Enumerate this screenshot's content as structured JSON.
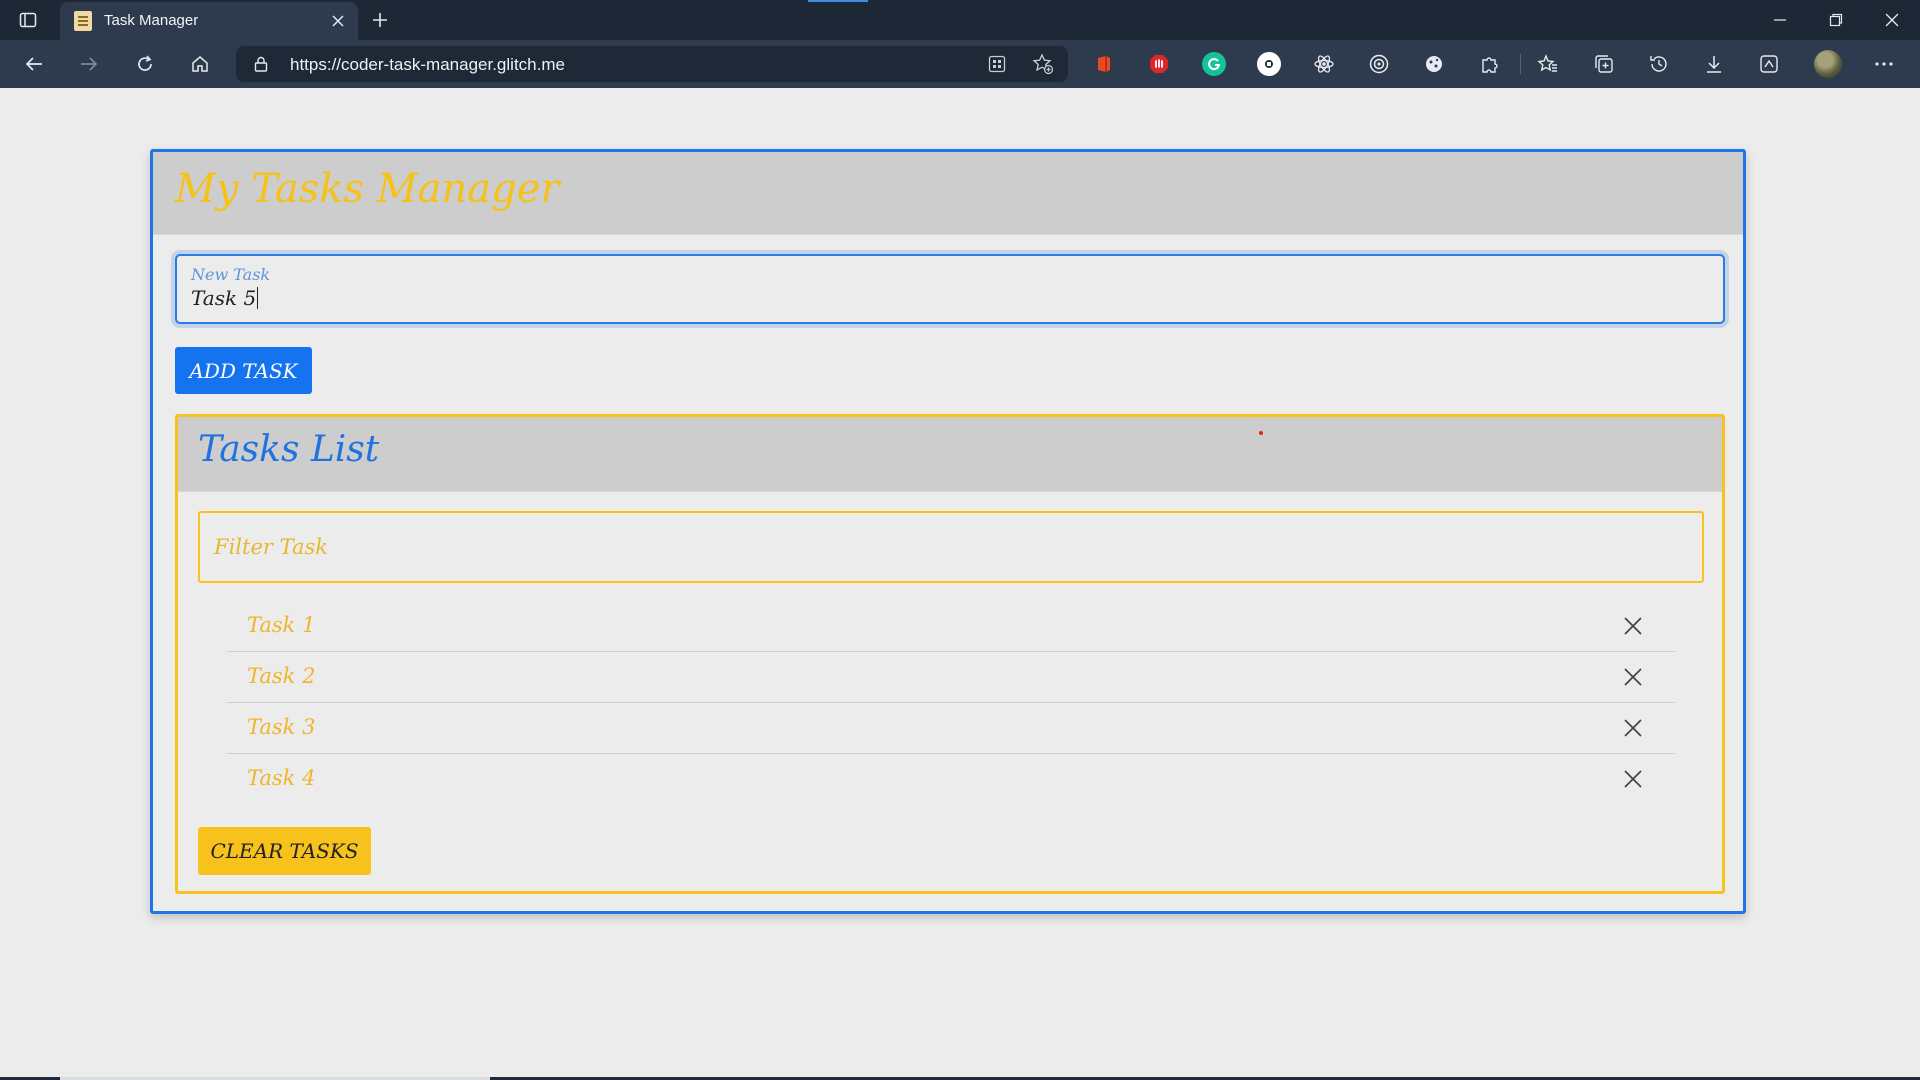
{
  "browser": {
    "tab_title": "Task Manager",
    "url": "https://coder-task-manager.glitch.me",
    "extensions": [
      {
        "name": "office-icon",
        "color": "#e74b26"
      },
      {
        "name": "adblock-icon",
        "color": "#e0262a"
      },
      {
        "name": "grammarly-icon",
        "color": "#15c39a"
      },
      {
        "name": "extension-circle-icon",
        "color": "#ffffff"
      },
      {
        "name": "react-devtools-icon",
        "color": "#e8ebf0"
      },
      {
        "name": "target-icon",
        "color": "#e8ebf0"
      },
      {
        "name": "cookie-icon",
        "color": "#e8ebf0"
      }
    ]
  },
  "app": {
    "title": "My Tasks Manager",
    "new_task": {
      "label": "New Task",
      "value": "Task 5"
    },
    "add_button": "ADD TASK",
    "tasks_card": {
      "title": "Tasks List",
      "filter_placeholder": "Filter Task",
      "tasks": [
        {
          "label": "Task 1"
        },
        {
          "label": "Task 2"
        },
        {
          "label": "Task 3"
        },
        {
          "label": "Task 4"
        }
      ],
      "clear_button": "CLEAR TASKS"
    }
  },
  "colors": {
    "primary_blue": "#1673f0",
    "accent_yellow": "#f7c21c",
    "header_gray": "#cdcdcd",
    "page_background": "#ececec"
  }
}
